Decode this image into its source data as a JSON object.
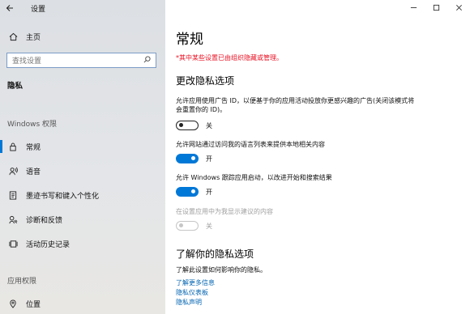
{
  "window": {
    "title": "设置",
    "back_icon": "back-arrow-icon",
    "minimize_icon": "minimize-icon",
    "maximize_icon": "maximize-icon",
    "close_icon": "close-icon"
  },
  "sidebar": {
    "home": {
      "label": "主页",
      "icon": "home-icon"
    },
    "search": {
      "placeholder": "查找设置",
      "icon": "search-icon"
    },
    "category_title": "隐私",
    "windows_section": "Windows 权限",
    "items": [
      {
        "label": "常规",
        "icon": "lock-icon",
        "active": true
      },
      {
        "label": "语音",
        "icon": "speech-icon",
        "active": false
      },
      {
        "label": "墨迹书写和键入个性化",
        "icon": "pen-keyboard-icon",
        "active": false
      },
      {
        "label": "诊断和反馈",
        "icon": "diagnostics-icon",
        "active": false
      },
      {
        "label": "活动历史记录",
        "icon": "activity-history-icon",
        "active": false
      }
    ],
    "app_section": "应用权限",
    "app_items": [
      {
        "label": "位置",
        "icon": "location-icon"
      }
    ]
  },
  "main": {
    "title": "常规",
    "managed_note": "*其中某些设置已由组织隐藏或管理。",
    "section_heading": "更改隐私选项",
    "settings": [
      {
        "description": "允许应用使用广告 ID，以便基于你的应用活动投放你更感兴趣的广告(关闭该模式将会重置你的 ID)。",
        "state": "关",
        "on": false,
        "disabled": false
      },
      {
        "description": "允许网站通过访问我的语言列表来提供本地相关内容",
        "state": "开",
        "on": true,
        "disabled": false
      },
      {
        "description": "允许 Windows 跟踪应用启动，以改进开始和搜索结果",
        "state": "开",
        "on": true,
        "disabled": false
      },
      {
        "description": "在设置应用中为我显示建议的内容",
        "state": "关",
        "on": false,
        "disabled": true
      }
    ],
    "learn_heading": "了解你的隐私选项",
    "learn_text": "了解此设置如何影响你的隐私。",
    "links": [
      "了解更多信息",
      "隐私仪表板",
      "隐私声明"
    ]
  },
  "colors": {
    "accent": "#0078d7",
    "warning": "#e81123",
    "link": "#0063b1"
  }
}
